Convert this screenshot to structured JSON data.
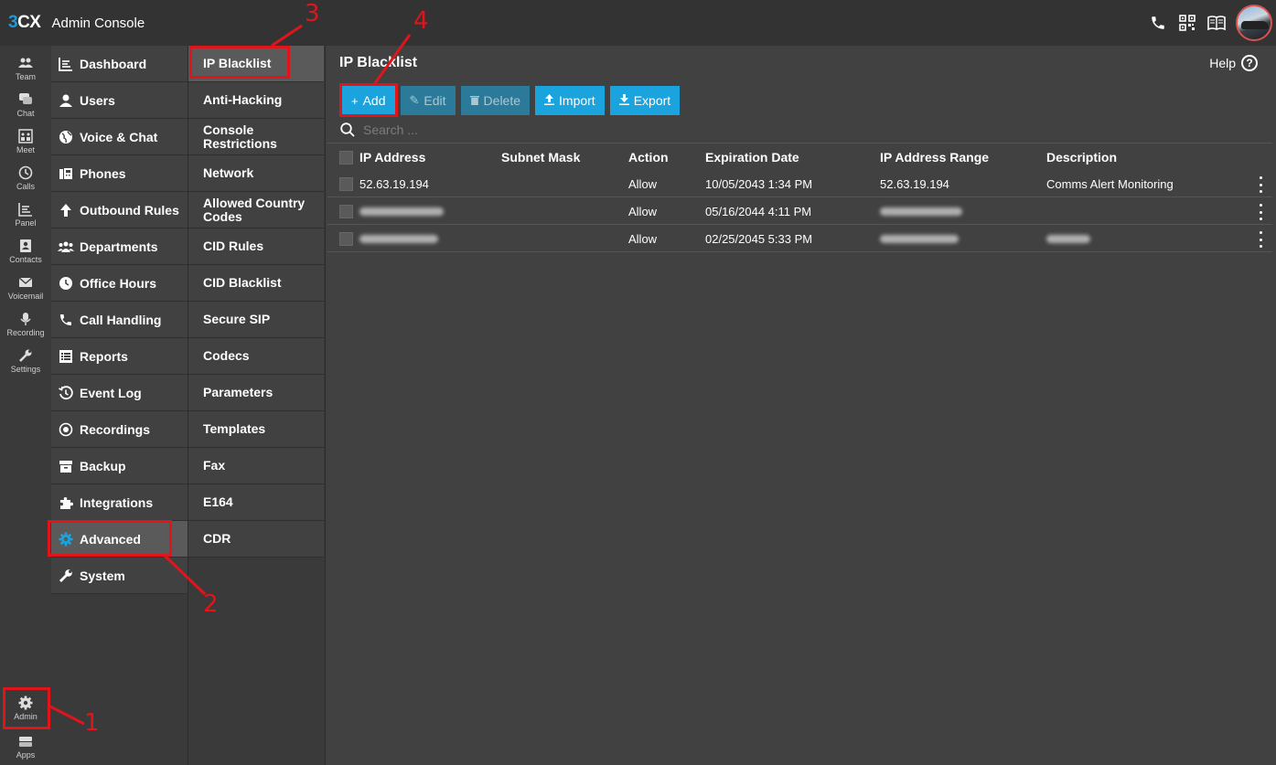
{
  "header": {
    "logo_3": "3",
    "logo_cx": "CX",
    "title": "Admin Console",
    "icons": [
      "phone-icon",
      "qr-code-icon",
      "book-icon"
    ]
  },
  "rail": {
    "items": [
      {
        "label": "Team",
        "icon": "team-icon"
      },
      {
        "label": "Chat",
        "icon": "chat-icon"
      },
      {
        "label": "Meet",
        "icon": "meet-icon"
      },
      {
        "label": "Calls",
        "icon": "calls-icon"
      },
      {
        "label": "Panel",
        "icon": "panel-icon"
      },
      {
        "label": "Contacts",
        "icon": "contacts-icon"
      },
      {
        "label": "Voicemail",
        "icon": "voicemail-icon"
      },
      {
        "label": "Recording",
        "icon": "microphone-icon"
      },
      {
        "label": "Settings",
        "icon": "wrench-icon"
      }
    ],
    "admin_label": "Admin",
    "apps_label": "Apps"
  },
  "nav": {
    "items": [
      {
        "label": "Dashboard",
        "icon": "dashboard-icon"
      },
      {
        "label": "Users",
        "icon": "user-icon"
      },
      {
        "label": "Voice & Chat",
        "icon": "globe-icon"
      },
      {
        "label": "Phones",
        "icon": "phones-icon"
      },
      {
        "label": "Outbound Rules",
        "icon": "arrow-up-icon"
      },
      {
        "label": "Departments",
        "icon": "departments-icon"
      },
      {
        "label": "Office Hours",
        "icon": "clock-icon"
      },
      {
        "label": "Call Handling",
        "icon": "phone-icon"
      },
      {
        "label": "Reports",
        "icon": "reports-icon"
      },
      {
        "label": "Event Log",
        "icon": "history-icon"
      },
      {
        "label": "Recordings",
        "icon": "record-icon"
      },
      {
        "label": "Backup",
        "icon": "archive-icon"
      },
      {
        "label": "Integrations",
        "icon": "puzzle-icon"
      },
      {
        "label": "Advanced",
        "icon": "gear-icon"
      },
      {
        "label": "System",
        "icon": "wrench-icon"
      }
    ],
    "active": "Advanced"
  },
  "subnav": {
    "items": [
      "IP Blacklist",
      "Anti-Hacking",
      "Console Restrictions",
      "Network",
      "Allowed Country Codes",
      "CID Rules",
      "CID Blacklist",
      "Secure SIP",
      "Codecs",
      "Parameters",
      "Templates",
      "Fax",
      "E164",
      "CDR"
    ],
    "active": "IP Blacklist"
  },
  "main": {
    "title": "IP Blacklist",
    "help_label": "Help",
    "help_symbol": "?",
    "toolbar": {
      "add": "Add",
      "edit": "Edit",
      "delete": "Delete",
      "import": "Import",
      "export": "Export"
    },
    "search_placeholder": "Search ...",
    "columns": [
      "IP Address",
      "Subnet Mask",
      "Action",
      "Expiration Date",
      "IP Address Range",
      "Description"
    ],
    "rows": [
      {
        "ip": "52.63.19.194",
        "subnet": "",
        "action": "Allow",
        "expiration": "10/05/2043 1:34 PM",
        "range": "52.63.19.194",
        "description": "Comms Alert Monitoring"
      },
      {
        "ip": "",
        "subnet": "",
        "action": "Allow",
        "expiration": "05/16/2044 4:11 PM",
        "range": "",
        "description": ""
      },
      {
        "ip": "",
        "subnet": "",
        "action": "Allow",
        "expiration": "02/25/2045 5:33 PM",
        "range": "",
        "description": ""
      }
    ]
  },
  "annotations": {
    "n1": "1",
    "n2": "2",
    "n3": "3",
    "n4": "4",
    "color": "#e0151b"
  },
  "colors": {
    "accent": "#1aa3dc",
    "annotation": "#e0151b"
  }
}
